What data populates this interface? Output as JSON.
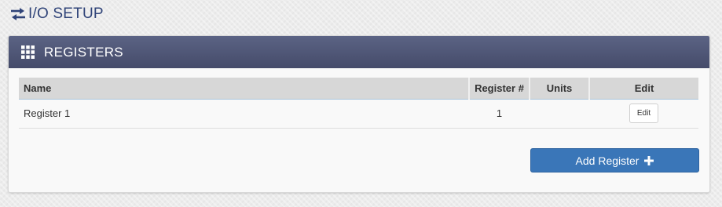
{
  "page": {
    "title": "I/O SETUP",
    "title_icon": "exchange-arrows-icon",
    "title_color": "#2f4378"
  },
  "panel": {
    "title": "REGISTERS",
    "title_icon": "grid-icon",
    "header_color": "#4f5577"
  },
  "table": {
    "headers": {
      "name": "Name",
      "register": "Register #",
      "units": "Units",
      "edit": "Edit"
    },
    "rows": [
      {
        "name": "Register 1",
        "register": "1",
        "units": "",
        "edit_label": "Edit"
      }
    ]
  },
  "actions": {
    "add_register_label": "Add Register",
    "add_register_icon": "plus-icon",
    "accent_color": "#3a76b8"
  }
}
